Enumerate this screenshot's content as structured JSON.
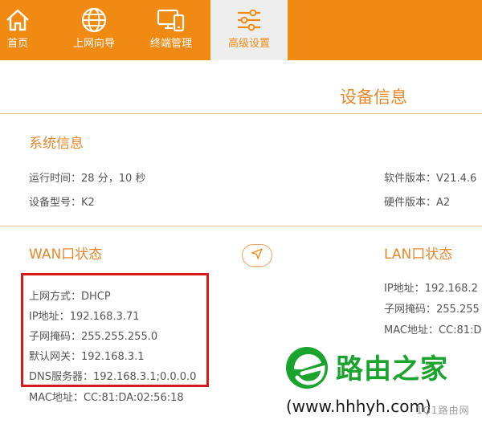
{
  "nav": {
    "items": [
      {
        "label": "首页",
        "icon": "home-icon"
      },
      {
        "label": "上网向导",
        "icon": "globe-icon"
      },
      {
        "label": "终端管理",
        "icon": "devices-icon"
      },
      {
        "label": "高级设置",
        "icon": "sliders-icon",
        "active": true
      }
    ]
  },
  "page": {
    "title": "设备信息"
  },
  "system": {
    "title": "系统信息",
    "uptime": {
      "label": "运行时间：",
      "value": "28 分，10 秒"
    },
    "model": {
      "label": "设备型号：",
      "value": "K2"
    },
    "software": {
      "label": "软件版本：",
      "value": "V21.4.6"
    },
    "hardware": {
      "label": "硬件版本：",
      "value": "A2"
    }
  },
  "wan": {
    "title": "WAN口状态",
    "mode": {
      "label": "上网方式：",
      "value": "DHCP"
    },
    "ip": {
      "label": "IP地址：",
      "value": "192.168.3.71"
    },
    "mask": {
      "label": "子网掩码：",
      "value": "255.255.255.0"
    },
    "gateway": {
      "label": "默认网关：",
      "value": "192.168.3.1"
    },
    "dns": {
      "label": "DNS服务器：",
      "value": "192.168.3.1;0.0.0.0"
    },
    "mac": {
      "label": "MAC地址：",
      "value": "CC:81:DA:02:56:18"
    }
  },
  "lan": {
    "title": "LAN口状态",
    "ip": {
      "label": "IP地址：",
      "value": "192.168.2"
    },
    "mask": {
      "label": "子网掩码：",
      "value": "255.255"
    },
    "mac": {
      "label": "MAC地址：",
      "value": "CC:81:D"
    }
  },
  "watermark": {
    "title": "路由之家",
    "url": "(www.hhhyh.com)",
    "sub": "1G1路由网"
  },
  "colors": {
    "accent": "#f08a13",
    "section_text": "#e8872a",
    "highlight": "#d41a1f",
    "watermark_green": "#1aa32d"
  }
}
